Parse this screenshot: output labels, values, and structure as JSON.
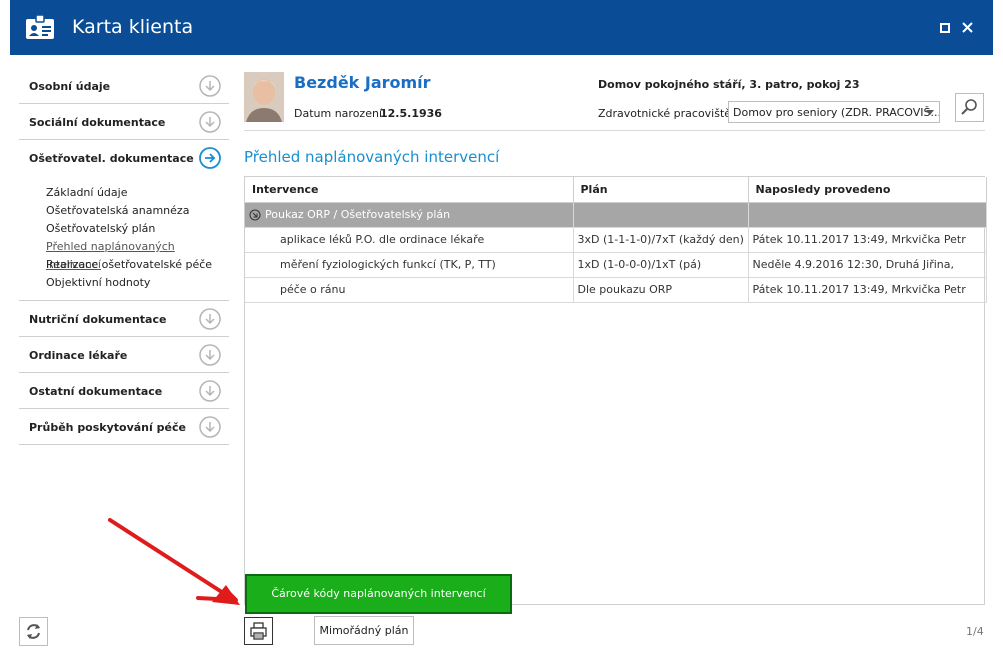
{
  "window": {
    "title": "Karta klienta",
    "maximize_glyph": "■",
    "close_glyph": "✕"
  },
  "sidebar": {
    "items": [
      {
        "label": "Osobní údaje",
        "state": "collapsed"
      },
      {
        "label": "Sociální dokumentace",
        "state": "collapsed"
      },
      {
        "label": "Ošetřovatel. dokumentace",
        "state": "expanded"
      },
      {
        "label": "Nutriční dokumentace",
        "state": "collapsed"
      },
      {
        "label": "Ordinace lékaře",
        "state": "collapsed"
      },
      {
        "label": "Ostatní dokumentace",
        "state": "collapsed"
      },
      {
        "label": "Průběh poskytování péče",
        "state": "collapsed"
      }
    ],
    "sub_items": [
      {
        "label": "Základní údaje"
      },
      {
        "label": "Ošetřovatelská anamnéza"
      },
      {
        "label": "Ošetřovatelský plán"
      },
      {
        "label": "Přehled naplánovaných intervencí"
      },
      {
        "label": "Realizace ošetřovatelské péče"
      },
      {
        "label": "Objektivní hodnoty"
      }
    ],
    "active_sub_item": "Přehled naplánovaných intervencí"
  },
  "patient": {
    "name": "Bezděk Jaromír",
    "dob_label": "Datum narození:",
    "dob": "12.5.1936",
    "facility": "Domov pokojného stáří, 3. patro, pokoj 23",
    "workplace_label": "Zdravotnické pracoviště:",
    "workplace_value": "Domov pro seniory (ZDR. PRACOVIŠ..."
  },
  "section": {
    "title": "Přehled naplánovaných intervencí"
  },
  "table": {
    "columns": [
      "Intervence",
      "Plán",
      "Naposledy provedeno"
    ],
    "group_label": "Poukaz ORP / Ošetřovatelský plán",
    "rows": [
      {
        "intervence": "aplikace léků P.O. dle ordinace lékaře",
        "plan": "3xD (1-1-1-0)/7xT (každý den)",
        "last": "Pátek 10.11.2017 13:49, Mrkvička Petr"
      },
      {
        "intervence": "měření fyziologických funkcí (TK, P, TT)",
        "plan": "1xD (1-0-0-0)/1xT (pá)",
        "last": "Neděle 4.9.2016 12:30, Druhá Jiřina,"
      },
      {
        "intervence": "péče o ránu",
        "plan": "Dle poukazu ORP",
        "last": "Pátek 10.11.2017 13:49, Mrkvička Petr"
      }
    ]
  },
  "footer": {
    "barcode_button": "Čárové kódy naplánovaných intervencí",
    "extra_plan_button": "Mimořádný plán",
    "pager": "1/4"
  },
  "colors": {
    "titlebar": "#0a4d96",
    "accent": "#1a8fcf",
    "group_row": "#a6a6a6",
    "green_button": "#1aae1a",
    "annotation_arrow": "#e01b1b"
  },
  "icons": {
    "app": "id-card-icon",
    "search": "magnifier-icon",
    "refresh": "refresh-icon",
    "print": "printer-icon",
    "expand": "chevron-down-circle-icon",
    "go": "arrow-right-circle-icon"
  }
}
